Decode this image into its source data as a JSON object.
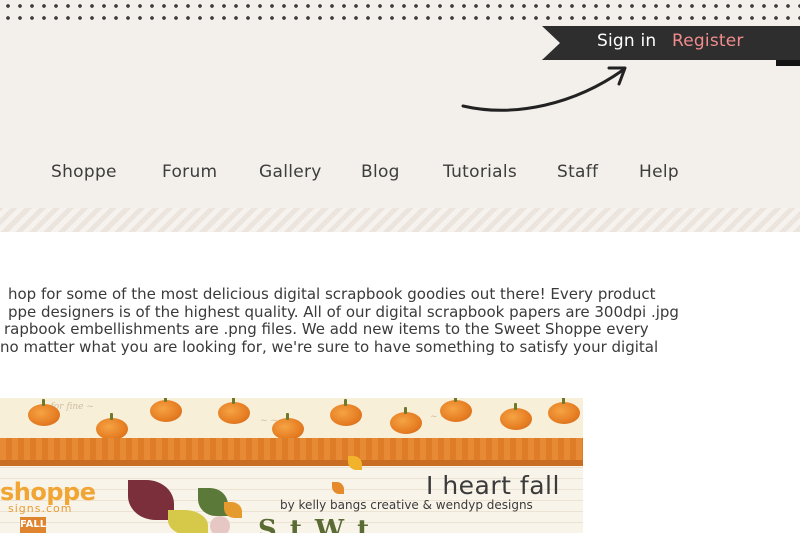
{
  "header": {
    "sign_in": "Sign in",
    "register": "Register",
    "nav": [
      "Shoppe",
      "Forum",
      "Gallery",
      "Blog",
      "Tutorials",
      "Staff",
      "Help"
    ]
  },
  "intro": {
    "lines": [
      "hop for some of the most delicious digital scrapbook goodies out there! Every product",
      "ppe designers is of the highest quality. All of our digital scrapbook papers are 300dpi .jpg",
      "rapbook embellishments are .png files. We add new items to the Sweet Shoppe every",
      " no matter what you are looking for, we're sure to have something to satisfy your digital"
    ]
  },
  "banner": {
    "logo_text": "shoppe",
    "logo_sub": "signs.com",
    "tag": "FALL",
    "title": "I heart fall",
    "credit": "by kelly bangs creative & wendyp designs",
    "partial_text": "S     t   W   t"
  },
  "colors": {
    "header_bg": "#f3efeb",
    "ribbon": "#2e2e2e",
    "register": "#f08c8c",
    "pumpkin": "#e67d22"
  }
}
